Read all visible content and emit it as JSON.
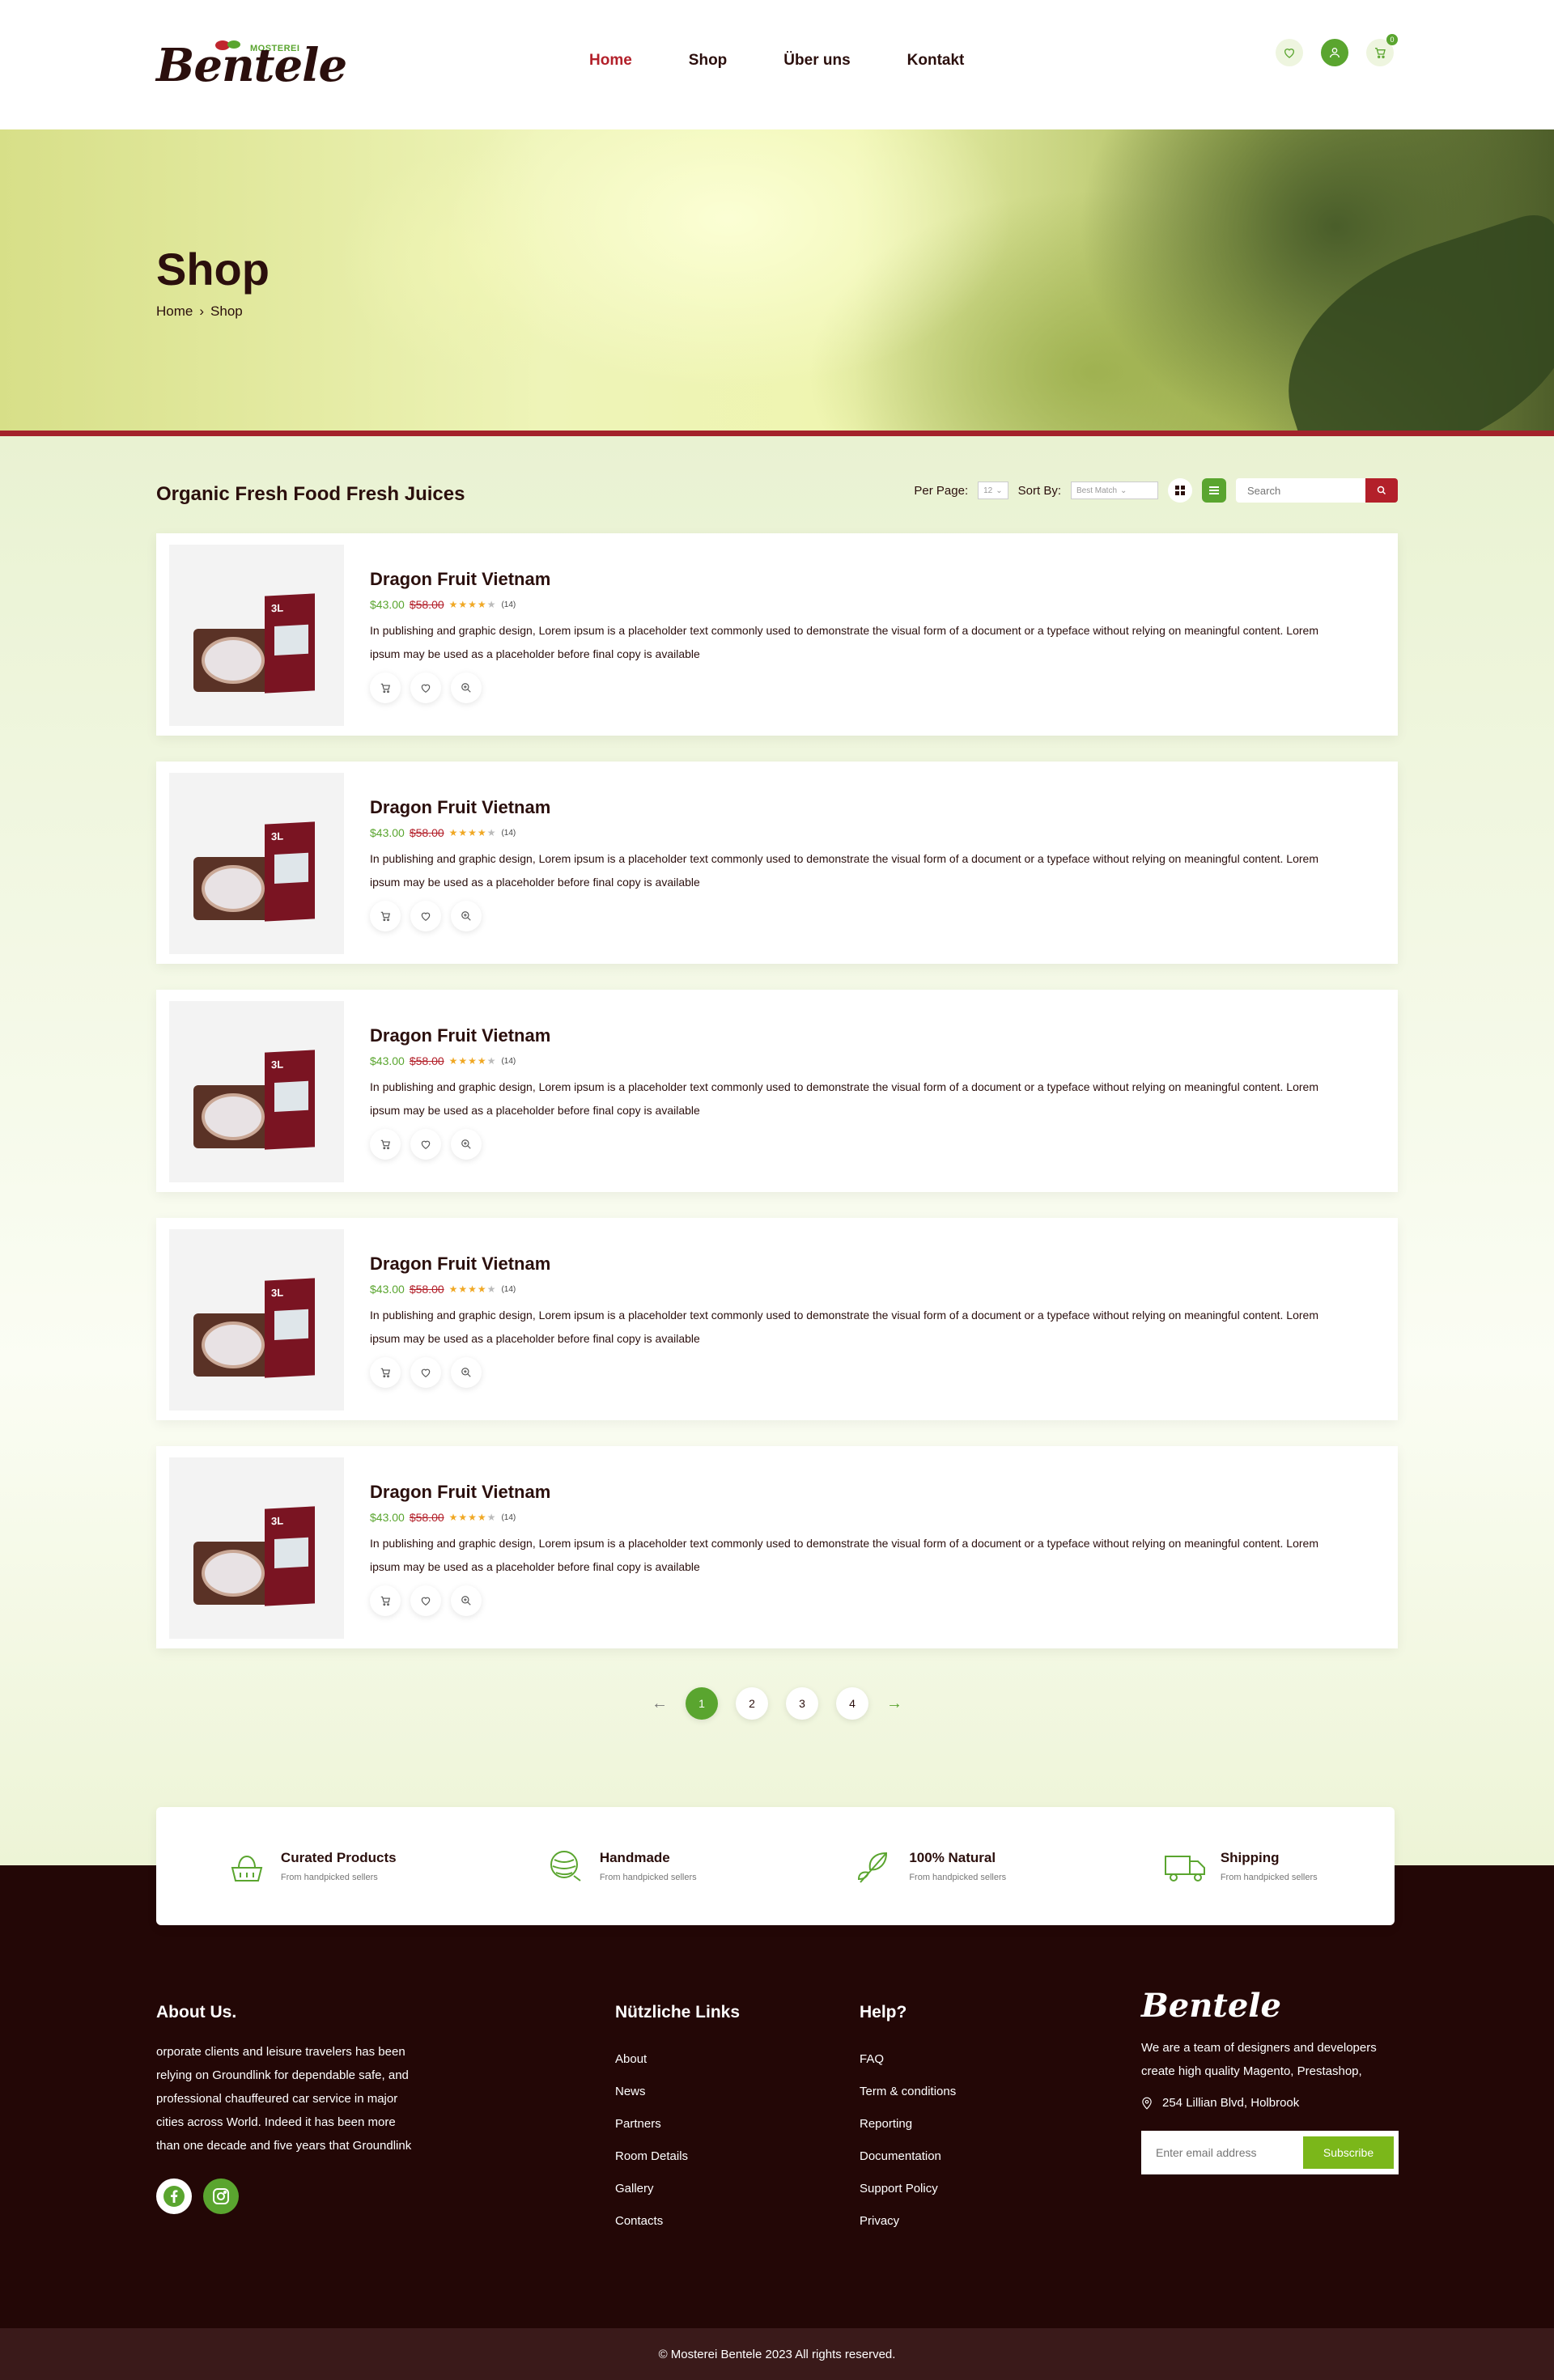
{
  "header": {
    "logo_text": "Bentele",
    "logo_tag": "MOSTEREI",
    "nav": [
      "Home",
      "Shop",
      "Über uns",
      "Kontakt"
    ],
    "cart_count": "0"
  },
  "banner": {
    "title": "Shop",
    "crumbs": [
      "Home",
      "Shop"
    ]
  },
  "toolbar": {
    "heading": "Organic Fresh Food Fresh Juices",
    "per_page_label": "Per Page:",
    "per_page_value": "12",
    "sort_label": "Sort By:",
    "sort_value": "Best Match",
    "search_placeholder": "Search"
  },
  "products": [
    {
      "title": "Dragon Fruit Vietnam",
      "price": "$43.00",
      "old_price": "$58.00",
      "rating_count": "(14)",
      "pack_label": "3L",
      "description": "In publishing and graphic design, Lorem ipsum is a placeholder text commonly used to demonstrate the visual form of a document or a typeface without relying on meaningful content. Lorem ipsum may be used as a placeholder before final copy is available"
    },
    {
      "title": "Dragon Fruit Vietnam",
      "price": "$43.00",
      "old_price": "$58.00",
      "rating_count": "(14)",
      "pack_label": "3L",
      "description": "In publishing and graphic design, Lorem ipsum is a placeholder text commonly used to demonstrate the visual form of a document or a typeface without relying on meaningful content. Lorem ipsum may be used as a placeholder before final copy is available"
    },
    {
      "title": "Dragon Fruit Vietnam",
      "price": "$43.00",
      "old_price": "$58.00",
      "rating_count": "(14)",
      "pack_label": "3L",
      "description": "In publishing and graphic design, Lorem ipsum is a placeholder text commonly used to demonstrate the visual form of a document or a typeface without relying on meaningful content. Lorem ipsum may be used as a placeholder before final copy is available"
    },
    {
      "title": "Dragon Fruit Vietnam",
      "price": "$43.00",
      "old_price": "$58.00",
      "rating_count": "(14)",
      "pack_label": "3L",
      "description": "In publishing and graphic design, Lorem ipsum is a placeholder text commonly used to demonstrate the visual form of a document or a typeface without relying on meaningful content. Lorem ipsum may be used as a placeholder before final copy is available"
    },
    {
      "title": "Dragon Fruit Vietnam",
      "price": "$43.00",
      "old_price": "$58.00",
      "rating_count": "(14)",
      "pack_label": "3L",
      "description": "In publishing and graphic design, Lorem ipsum is a placeholder text commonly used to demonstrate the visual form of a document or a typeface without relying on meaningful content. Lorem ipsum may be used as a placeholder before final copy is available"
    }
  ],
  "rating_stars": 4,
  "pagination": {
    "pages": [
      "1",
      "2",
      "3",
      "4"
    ],
    "current": "1"
  },
  "features": [
    {
      "title": "Curated Products",
      "subtitle": "From handpicked sellers",
      "icon": "basket-icon"
    },
    {
      "title": "Handmade",
      "subtitle": "From handpicked sellers",
      "icon": "yarn-icon"
    },
    {
      "title": "100% Natural",
      "subtitle": "From handpicked sellers",
      "icon": "leaf-icon"
    },
    {
      "title": "Shipping",
      "subtitle": "From handpicked sellers",
      "icon": "truck-icon"
    }
  ],
  "footer": {
    "about_title": "About Us.",
    "about_text": "orporate clients and leisure travelers has been relying on Groundlink for dependable safe, and professional chauffeured car service in major cities across World. Indeed it has been more than one decade and five years that Groundlink",
    "links_title": "Nützliche Links",
    "links": [
      "About",
      "News",
      "Partners",
      "Room Details",
      "Gallery",
      "Contacts"
    ],
    "help_title": "Help?",
    "help": [
      "FAQ",
      "Term & conditions",
      "Reporting",
      "Documentation",
      "Support Policy",
      "Privacy"
    ],
    "brand_text": "We are a team of designers and developers create high quality Magento, Prestashop,",
    "address": "254 Lillian Blvd, Holbrook",
    "email_placeholder": "Enter email address",
    "subscribe_label": "Subscribe",
    "copyright": "©  Mosterei Bentele 2023 All rights reserved."
  },
  "colors": {
    "accent_green": "#5aa52f",
    "accent_red": "#b3202a",
    "footer_bg": "#230706"
  }
}
